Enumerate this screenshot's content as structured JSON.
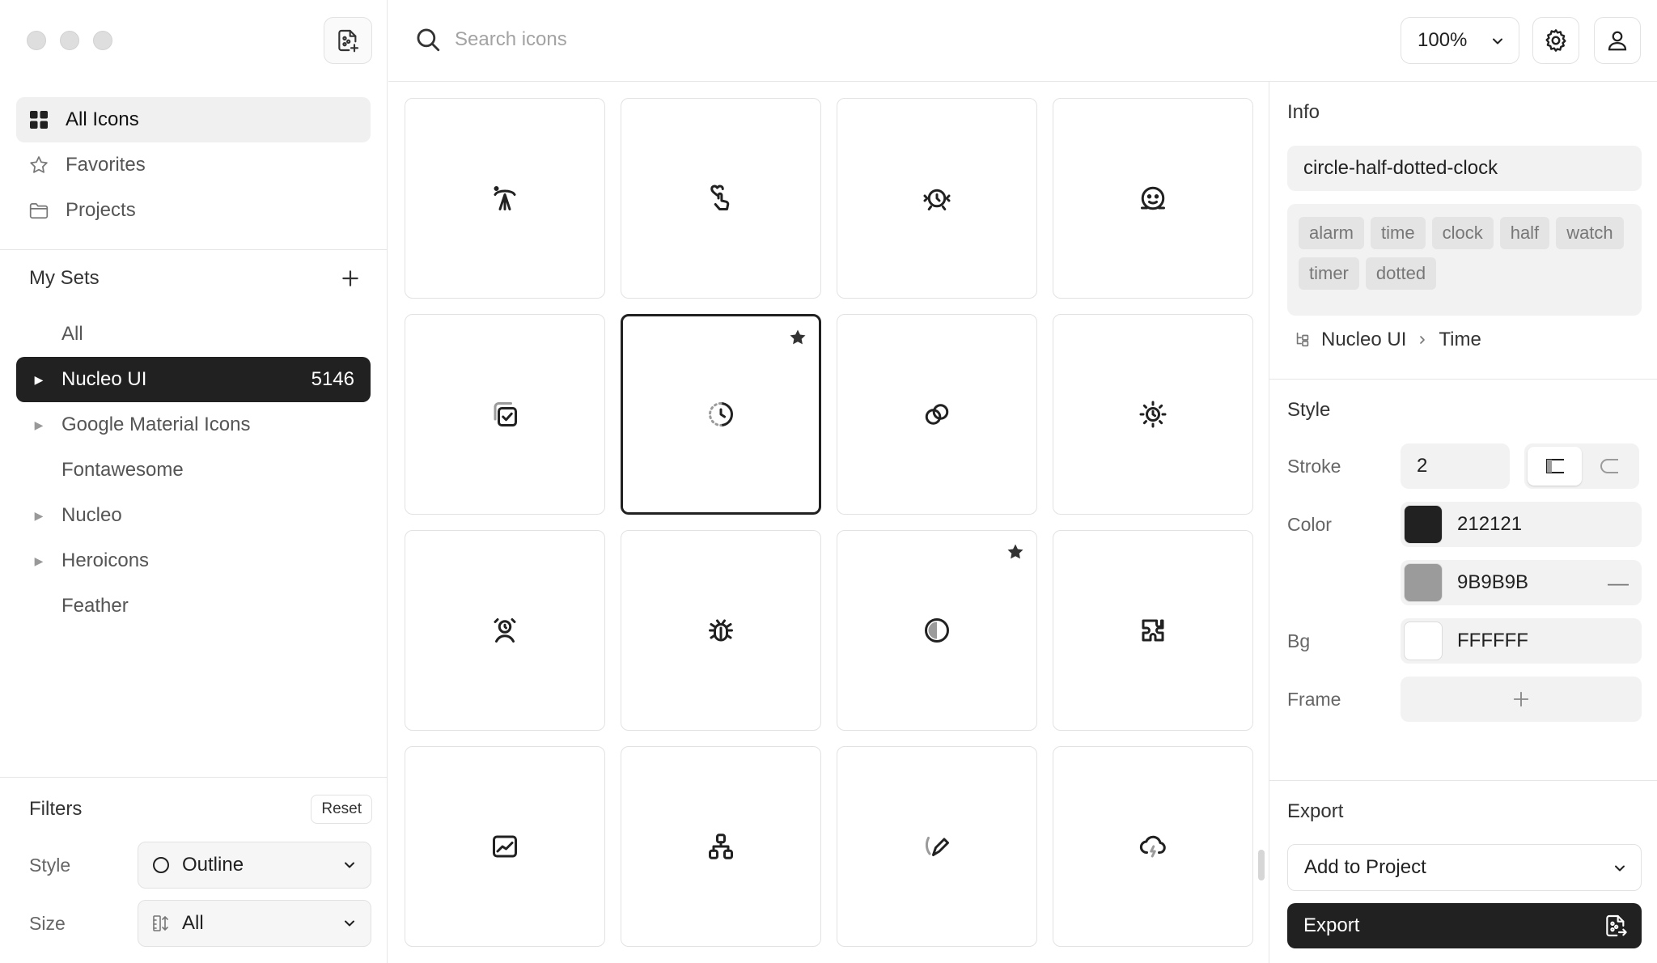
{
  "sidebar": {
    "nav": [
      {
        "label": "All Icons",
        "icon": "grid-icon",
        "active": true
      },
      {
        "label": "Favorites",
        "icon": "star-icon",
        "active": false
      },
      {
        "label": "Projects",
        "icon": "folder-icon",
        "active": false
      }
    ],
    "my_sets_title": "My Sets",
    "sets": [
      {
        "label": "All",
        "expandable": false,
        "active": false,
        "count": ""
      },
      {
        "label": "Nucleo UI",
        "expandable": true,
        "active": true,
        "count": "5146"
      },
      {
        "label": "Google Material Icons",
        "expandable": true,
        "active": false,
        "count": ""
      },
      {
        "label": "Fontawesome",
        "expandable": false,
        "active": false,
        "count": ""
      },
      {
        "label": "Nucleo",
        "expandable": true,
        "active": false,
        "count": ""
      },
      {
        "label": "Heroicons",
        "expandable": true,
        "active": false,
        "count": ""
      },
      {
        "label": "Feather",
        "expandable": false,
        "active": false,
        "count": ""
      }
    ],
    "filters": {
      "title": "Filters",
      "reset_label": "Reset",
      "style_label": "Style",
      "style_value": "Outline",
      "size_label": "Size",
      "size_value": "All"
    }
  },
  "topbar": {
    "search_placeholder": "Search icons",
    "zoom": "100%"
  },
  "grid": {
    "icons": [
      {
        "icon": "satellite-dish-icon",
        "favorite": false,
        "selected": false
      },
      {
        "icon": "hand-heart-icon",
        "favorite": false,
        "selected": false
      },
      {
        "icon": "alarm-clock-rings-icon",
        "favorite": false,
        "selected": false
      },
      {
        "icon": "face-scan-icon",
        "favorite": false,
        "selected": false
      },
      {
        "icon": "square-checks-icon",
        "favorite": false,
        "selected": false
      },
      {
        "icon": "circle-half-dotted-clock-icon",
        "favorite": true,
        "selected": true
      },
      {
        "icon": "rings-icon",
        "favorite": false,
        "selected": false
      },
      {
        "icon": "sun-clock-icon",
        "favorite": false,
        "selected": false
      },
      {
        "icon": "alarm-person-icon",
        "favorite": false,
        "selected": false
      },
      {
        "icon": "bug-icon",
        "favorite": false,
        "selected": false
      },
      {
        "icon": "circle-half-icon",
        "favorite": true,
        "selected": false
      },
      {
        "icon": "puzzle-piece-icon",
        "favorite": false,
        "selected": false
      },
      {
        "icon": "chart-square-icon",
        "favorite": false,
        "selected": false
      },
      {
        "icon": "hierarchy-icon",
        "favorite": false,
        "selected": false
      },
      {
        "icon": "pencil-swoosh-icon",
        "favorite": false,
        "selected": false
      },
      {
        "icon": "cloud-lightning-icon",
        "favorite": false,
        "selected": false
      }
    ]
  },
  "panel": {
    "info_title": "Info",
    "icon_name": "circle-half-dotted-clock",
    "tags": [
      "alarm",
      "time",
      "clock",
      "half",
      "watch",
      "timer",
      "dotted"
    ],
    "breadcrumb": {
      "set": "Nucleo UI",
      "category": "Time"
    },
    "style_title": "Style",
    "stroke_label": "Stroke",
    "stroke_value": "2",
    "color_label": "Color",
    "primary_color": "212121",
    "secondary_color": "9B9B9B",
    "bg_label": "Bg",
    "bg_color": "FFFFFF",
    "frame_label": "Frame",
    "export_title": "Export",
    "add_to_project": "Add to Project",
    "export_label": "Export"
  },
  "colors": {
    "primary": "#212121",
    "secondary": "#9B9B9B",
    "bg": "#FFFFFF",
    "border": "#E2E2E2"
  }
}
